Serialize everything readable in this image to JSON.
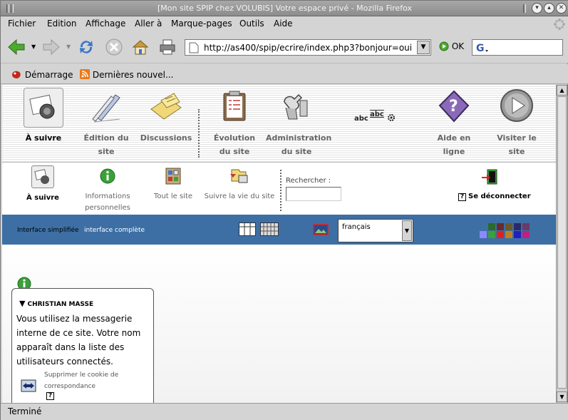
{
  "window": {
    "title": "[Mon site SPIP chez VOLUBIS] Votre espace privé - Mozilla Firefox"
  },
  "menubar": {
    "items": [
      {
        "label": "Fichier"
      },
      {
        "label": "Edition"
      },
      {
        "label": "Affichage"
      },
      {
        "label": "Aller à"
      },
      {
        "label": "Marque-pages"
      },
      {
        "label": "Outils"
      },
      {
        "label": "Aide"
      }
    ]
  },
  "navbar": {
    "url": "http://as400/spip/ecrire/index.php3?bonjour=oui",
    "ok_label": "OK"
  },
  "bookmarks": {
    "items": [
      {
        "label": "Démarrage"
      },
      {
        "label": "Dernières nouvel..."
      }
    ]
  },
  "spip_top": {
    "items": [
      {
        "line1": "À suivre",
        "line2": ""
      },
      {
        "line1": "Édition du site",
        "line2": ""
      },
      {
        "line1": "Discussions",
        "line2": ""
      },
      {
        "line1": "Évolution",
        "line2": "du site"
      },
      {
        "line1": "Administration",
        "line2": "du site"
      },
      {
        "line1": "Aide en ligne",
        "line2": ""
      },
      {
        "line1": "Visiter le site",
        "line2": ""
      }
    ],
    "abc_label_1": "abc",
    "abc_label_2": "abc"
  },
  "spip_sub": {
    "items": [
      {
        "line1": "À suivre",
        "line2": ""
      },
      {
        "line1": "Informations",
        "line2": "personnelles"
      },
      {
        "line1": "Tout le site",
        "line2": ""
      },
      {
        "line1": "Suivre la vie du site",
        "line2": ""
      }
    ],
    "search_label": "Rechercher :",
    "logout_label": "Se déconnecter",
    "help_glyph": "?"
  },
  "bluebar": {
    "simple_label": "Interface simplifiée",
    "complete_label": "interface complète",
    "language": "français",
    "colors": [
      "#2a6a2a",
      "#6a2a2a",
      "#6a5a2a",
      "#2a2a6a",
      "#6a3a6a",
      "#4a4a4a",
      "#8a8aff",
      "#3aa03a",
      "#e02020",
      "#c08020",
      "#2020c0",
      "#c02080",
      "#707070"
    ]
  },
  "card": {
    "name": "CHRISTIAN MASSE",
    "text": "Vous utilisez la messagerie interne de ce site. Votre nom apparaît dans la liste des utilisateurs connectés.",
    "cookie_line1": "Supprimer le cookie de",
    "cookie_line2": "correspondance",
    "help_glyph": "?"
  },
  "status": {
    "text": "Terminé"
  }
}
